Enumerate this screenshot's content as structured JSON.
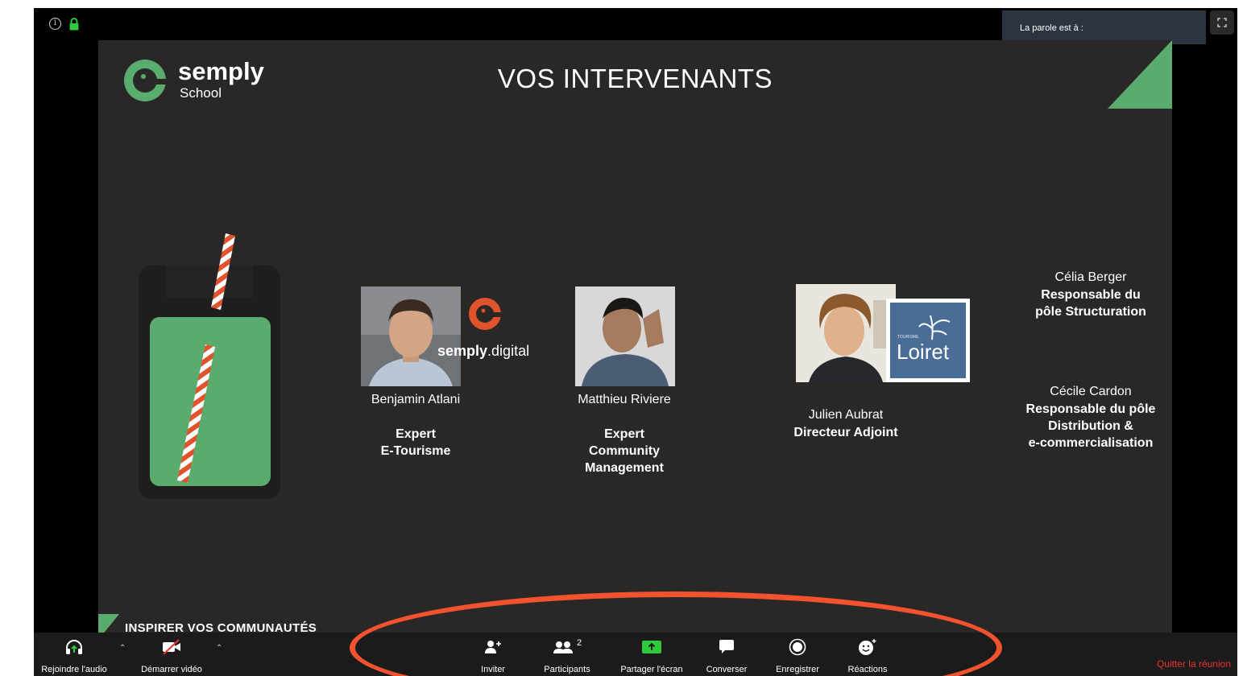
{
  "meeting": {
    "speaker_label": "La parole est à :"
  },
  "slide": {
    "brand_name": "semply",
    "brand_sub": "School",
    "title": "VOS INTERVENANTS",
    "footer": "INSPIRER VOS COMMUNAUTÉS",
    "partner_logo_bold": "semply",
    "partner_logo_light": ".digital",
    "loiret_logo": "Loiret",
    "loiret_small": "TOURISME",
    "speakers": [
      {
        "name": "Benjamin Atlani",
        "role": "Expert\nE-Tourisme"
      },
      {
        "name": "Matthieu Riviere",
        "role": "Expert\nCommunity\nManagement"
      },
      {
        "name": "Julien Aubrat",
        "role": "Directeur Adjoint"
      },
      {
        "name": "Célia Berger",
        "role": "Responsable du\npôle Structuration"
      },
      {
        "name": "Cécile Cardon",
        "role": "Responsable du pôle\nDistribution &\ne-commercialisation"
      }
    ]
  },
  "toolbar": {
    "join_audio": "Rejoindre l'audio",
    "start_video": "Démarrer vidéo",
    "invite": "Inviter",
    "participants": "Participants",
    "participants_count": "2",
    "share_screen": "Partager l'écran",
    "chat": "Converser",
    "record": "Enregistrer",
    "reactions": "Réactions",
    "leave": "Quitter la réunion"
  },
  "colors": {
    "slide_bg": "#292826",
    "brand_green": "#5aac6e",
    "straw_red": "#e0532c",
    "toolbar_bg": "#1b1b1b",
    "leave_red": "#e8342f",
    "annotation": "#f2522e",
    "speaker_box": "#2b3440"
  }
}
